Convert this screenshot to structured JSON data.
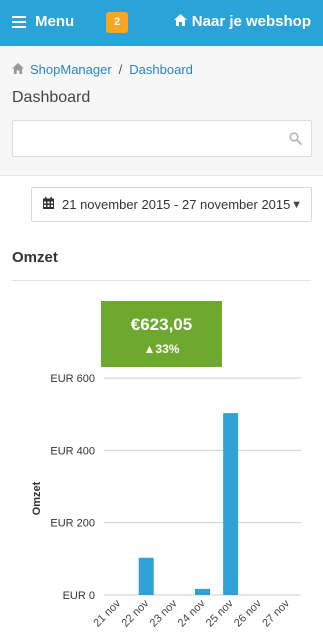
{
  "header": {
    "menu_label": "Menu",
    "badge_count": "2",
    "shop_link_label": "Naar je webshop"
  },
  "breadcrumb": {
    "items": [
      "ShopManager",
      "Dashboard"
    ],
    "separator": "/"
  },
  "page": {
    "title": "Dashboard"
  },
  "search": {
    "value": "",
    "placeholder": ""
  },
  "date_range": {
    "label": "21 november 2015 - 27 november 2015"
  },
  "revenue": {
    "section_title": "Omzet",
    "total": "€623,05",
    "change": "▲33%"
  },
  "colors": {
    "header_bg": "#2aa3d8",
    "badge": "#f5a623",
    "kpi_bg": "#6fa82f",
    "bar": "#2fa1d6",
    "link": "#2a83c6"
  },
  "icons": {
    "menu": "hamburger-icon",
    "home": "home-icon",
    "search": "search-icon",
    "calendar": "calendar-icon",
    "dropdown": "caret-down-icon"
  },
  "chart_data": {
    "type": "bar",
    "ylabel": "Omzet",
    "xlabel": "",
    "categories": [
      "21 nov",
      "22 nov",
      "23 nov",
      "24 nov",
      "25 nov",
      "26 nov",
      "27 nov"
    ],
    "values": [
      0,
      103,
      0,
      17,
      503,
      0,
      0
    ],
    "ylim": [
      0,
      600
    ],
    "yticks": [
      0,
      200,
      400,
      600
    ],
    "ytick_labels": [
      "EUR 0",
      "EUR 200",
      "EUR 400",
      "EUR 600"
    ],
    "grid": true,
    "color": "#2fa1d6"
  }
}
